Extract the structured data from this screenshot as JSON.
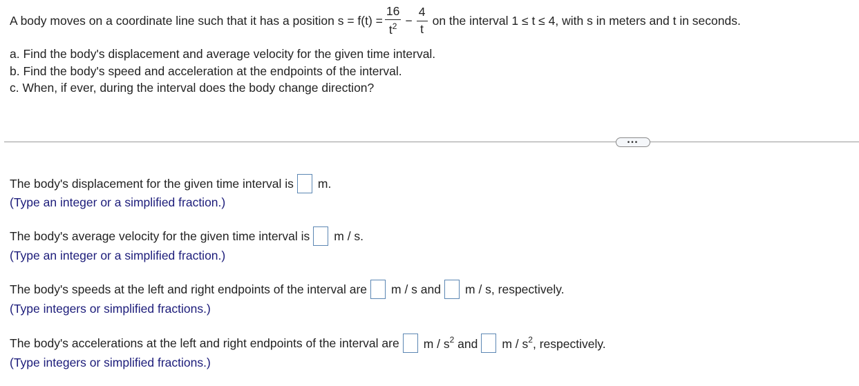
{
  "problem": {
    "intro": "A body moves on a coordinate line such that it has a position s = f(t) =",
    "fraction1": {
      "numerator": "16",
      "denominator_base": "t",
      "denominator_exp": "2"
    },
    "operator": "−",
    "fraction2": {
      "numerator": "4",
      "denominator": "t"
    },
    "suffix": "on the interval 1 ≤ t ≤ 4, with s in meters and t in seconds.",
    "parts": [
      "a. Find the body's displacement and average velocity for the given time interval.",
      "b. Find the body's speed and acceleration at the endpoints of the interval.",
      "c. When, if ever, during the interval does the body change direction?"
    ]
  },
  "divider": {
    "more_button": "•••"
  },
  "questions": {
    "displacement": {
      "prefix": "The body's displacement for the given time interval is",
      "answer": "",
      "unit": "m.",
      "hint": "(Type an integer or a simplified fraction.)"
    },
    "avg_velocity": {
      "prefix": "The body's average velocity for the given time interval is",
      "answer": "",
      "unit": "m / s.",
      "hint": "(Type an integer or a simplified fraction.)"
    },
    "speeds": {
      "prefix": "The body's speeds at the left and right endpoints of the interval are",
      "answer_left": "",
      "unit_left": "m / s and",
      "answer_right": "",
      "unit_right": "m / s, respectively.",
      "hint": "(Type integers or simplified fractions.)"
    },
    "accelerations": {
      "prefix": "The body's accelerations at the left and right endpoints of the interval are",
      "answer_left": "",
      "unit_left_base": "m / s",
      "unit_left_exp": "2",
      "unit_left_tail": " and",
      "answer_right": "",
      "unit_right_base": "m / s",
      "unit_right_exp": "2",
      "unit_right_tail": ", respectively.",
      "hint": "(Type integers or simplified fractions.)"
    }
  },
  "colors": {
    "text": "#222222",
    "hint": "#1c1c7a",
    "input_border": "#5b86b3",
    "divider": "#999999"
  }
}
